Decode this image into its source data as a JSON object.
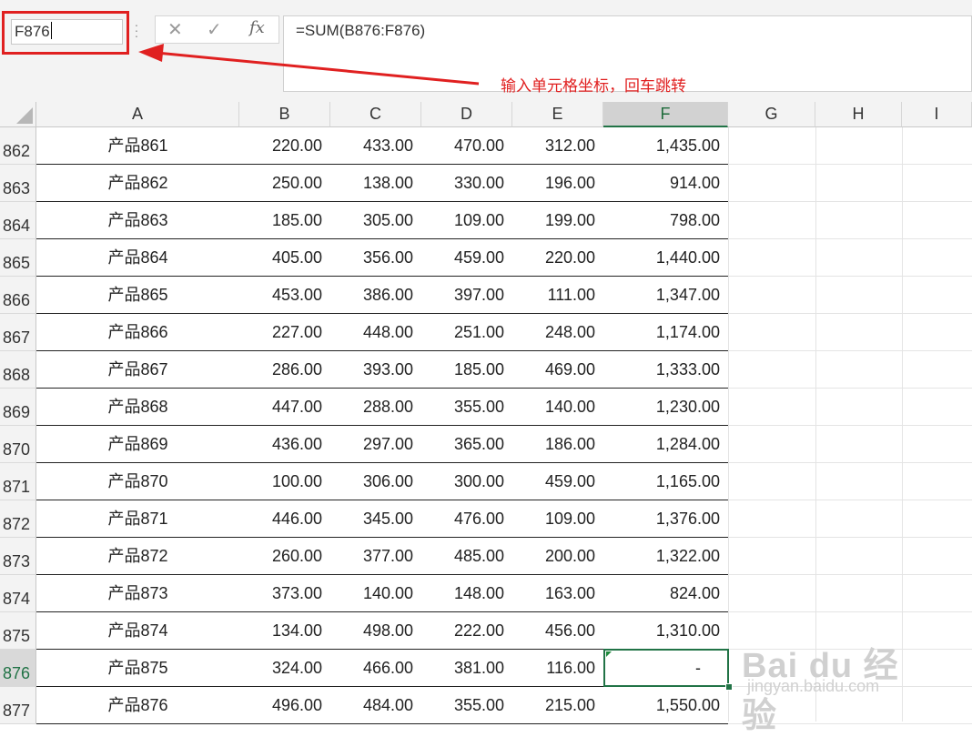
{
  "name_box": {
    "value": "F876"
  },
  "formula_bar": {
    "cancel_icon": "close-icon",
    "enter_icon": "check-icon",
    "function_icon": "fx-icon",
    "fx_label": "fx",
    "formula": "=SUM(B876:F876)"
  },
  "annotation": {
    "text": "输入单元格坐标，回车跳转",
    "color": "#e02020"
  },
  "columns": [
    "A",
    "B",
    "C",
    "D",
    "E",
    "F",
    "G",
    "H",
    "I"
  ],
  "active_column": "F",
  "active_row": "876",
  "rows": [
    {
      "num": "862",
      "a": "产品861",
      "b": "220.00",
      "c": "433.00",
      "d": "470.00",
      "e": "312.00",
      "f": "1,435.00"
    },
    {
      "num": "863",
      "a": "产品862",
      "b": "250.00",
      "c": "138.00",
      "d": "330.00",
      "e": "196.00",
      "f": "914.00"
    },
    {
      "num": "864",
      "a": "产品863",
      "b": "185.00",
      "c": "305.00",
      "d": "109.00",
      "e": "199.00",
      "f": "798.00"
    },
    {
      "num": "865",
      "a": "产品864",
      "b": "405.00",
      "c": "356.00",
      "d": "459.00",
      "e": "220.00",
      "f": "1,440.00"
    },
    {
      "num": "866",
      "a": "产品865",
      "b": "453.00",
      "c": "386.00",
      "d": "397.00",
      "e": "111.00",
      "f": "1,347.00"
    },
    {
      "num": "867",
      "a": "产品866",
      "b": "227.00",
      "c": "448.00",
      "d": "251.00",
      "e": "248.00",
      "f": "1,174.00"
    },
    {
      "num": "868",
      "a": "产品867",
      "b": "286.00",
      "c": "393.00",
      "d": "185.00",
      "e": "469.00",
      "f": "1,333.00"
    },
    {
      "num": "869",
      "a": "产品868",
      "b": "447.00",
      "c": "288.00",
      "d": "355.00",
      "e": "140.00",
      "f": "1,230.00"
    },
    {
      "num": "870",
      "a": "产品869",
      "b": "436.00",
      "c": "297.00",
      "d": "365.00",
      "e": "186.00",
      "f": "1,284.00"
    },
    {
      "num": "871",
      "a": "产品870",
      "b": "100.00",
      "c": "306.00",
      "d": "300.00",
      "e": "459.00",
      "f": "1,165.00"
    },
    {
      "num": "872",
      "a": "产品871",
      "b": "446.00",
      "c": "345.00",
      "d": "476.00",
      "e": "109.00",
      "f": "1,376.00"
    },
    {
      "num": "873",
      "a": "产品872",
      "b": "260.00",
      "c": "377.00",
      "d": "485.00",
      "e": "200.00",
      "f": "1,322.00"
    },
    {
      "num": "874",
      "a": "产品873",
      "b": "373.00",
      "c": "140.00",
      "d": "148.00",
      "e": "163.00",
      "f": "824.00"
    },
    {
      "num": "875",
      "a": "产品874",
      "b": "134.00",
      "c": "498.00",
      "d": "222.00",
      "e": "456.00",
      "f": "1,310.00"
    },
    {
      "num": "876",
      "a": "产品875",
      "b": "324.00",
      "c": "466.00",
      "d": "381.00",
      "e": "116.00",
      "f": "-"
    },
    {
      "num": "877",
      "a": "产品876",
      "b": "496.00",
      "c": "484.00",
      "d": "355.00",
      "e": "215.00",
      "f": "1,550.00"
    }
  ],
  "watermark": {
    "brand": "Bai du 经验",
    "url": "jingyan.baidu.com"
  },
  "colors": {
    "accent": "#217346",
    "annotation": "#e02020"
  }
}
